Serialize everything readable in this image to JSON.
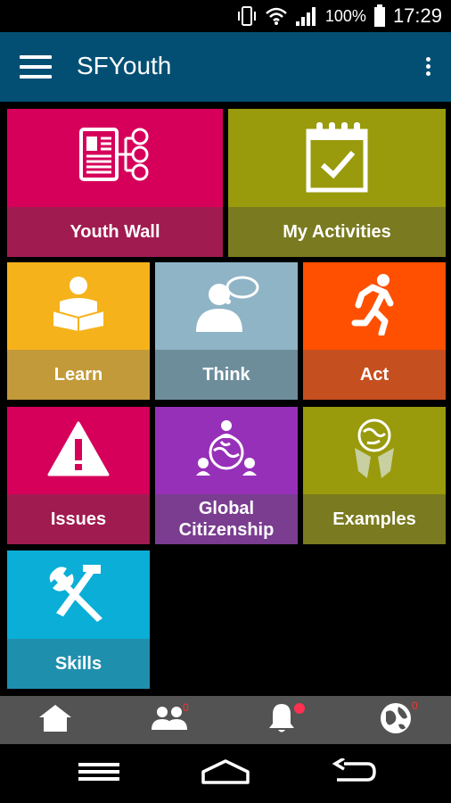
{
  "status_bar": {
    "battery_percent": "100%",
    "time": "17:29",
    "icons": [
      "vibrate-icon",
      "wifi-icon",
      "signal-icon",
      "battery-icon"
    ]
  },
  "app_bar": {
    "title": "SFYouth",
    "icons": [
      "menu-icon",
      "overflow-menu-icon"
    ]
  },
  "tiles": [
    {
      "label": "Youth Wall",
      "icon": "news-network-icon",
      "color": "#d6005b",
      "label_bg": "#a01b4f"
    },
    {
      "label": "My Activities",
      "icon": "calendar-check-icon",
      "color": "#999a0c",
      "label_bg": "#7a7a20"
    },
    {
      "label": "Learn",
      "icon": "reading-person-icon",
      "color": "#f6b21a",
      "label_bg": "#c29a3a"
    },
    {
      "label": "Think",
      "icon": "thinking-person-icon",
      "color": "#8fb4c6",
      "label_bg": "#6d8d9b"
    },
    {
      "label": "Act",
      "icon": "running-person-icon",
      "color": "#fe5000",
      "label_bg": "#c64f20"
    },
    {
      "label": "Issues",
      "icon": "warning-icon",
      "color": "#d6005b",
      "label_bg": "#a01b4f"
    },
    {
      "label": "Global Citizenship",
      "icon": "globe-people-icon",
      "color": "#9730b9",
      "label_bg": "#7a3d8f"
    },
    {
      "label": "Examples",
      "icon": "globe-hands-icon",
      "color": "#999a0c",
      "label_bg": "#7a7a20"
    },
    {
      "label": "Skills",
      "icon": "tools-icon",
      "color": "#0aaed6",
      "label_bg": "#1f8fae"
    }
  ],
  "bottom_nav": {
    "items": [
      {
        "name": "home",
        "icon": "home-icon"
      },
      {
        "name": "people",
        "icon": "people-icon",
        "badge": "0"
      },
      {
        "name": "notifications",
        "icon": "bell-icon"
      },
      {
        "name": "world",
        "icon": "globe-icon",
        "badge": "0"
      }
    ],
    "background": "#535353",
    "badge_color": "#ff3030"
  },
  "system_nav": {
    "icons": [
      "recent-apps-icon",
      "home-outline-icon",
      "back-icon"
    ]
  },
  "colors": {
    "app_bar": "#034f74",
    "background": "#000000"
  }
}
